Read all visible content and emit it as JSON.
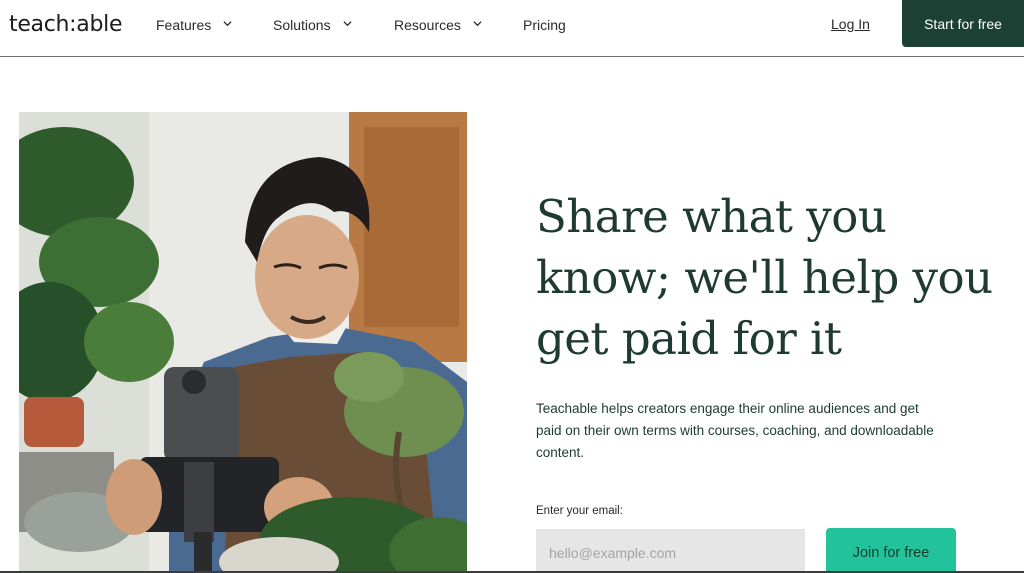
{
  "header": {
    "logo": "teach:able",
    "nav": [
      {
        "label": "Features"
      },
      {
        "label": "Solutions"
      },
      {
        "label": "Resources"
      },
      {
        "label": "Pricing"
      }
    ],
    "login_label": "Log In",
    "start_label": "Start for free"
  },
  "hero": {
    "headline_lines": [
      "Share what you",
      "know; we'll help you",
      "get paid for it"
    ],
    "subcopy_lines": [
      "Teachable helps creators engage their online audiences and get",
      "paid on their own terms with courses, coaching, and downloadable",
      "content."
    ],
    "email_label": "Enter your email:",
    "email_placeholder": "hello@example.com",
    "join_label": "Join for free"
  },
  "colors": {
    "brand_dark": "#1d4034",
    "accent": "#22c39a",
    "headline": "#1e3a32"
  },
  "icons": {
    "dropdown": "chevron-down-icon"
  }
}
